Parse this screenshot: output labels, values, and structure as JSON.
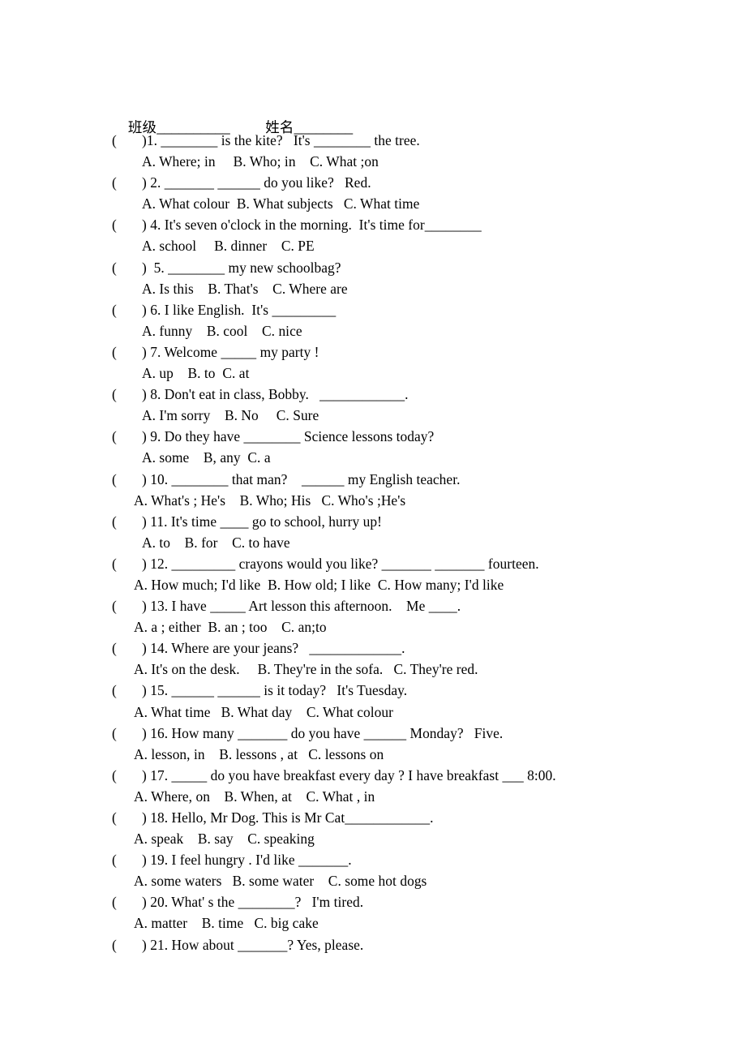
{
  "document": {
    "type": "english-multiple-choice-worksheet",
    "page_background": "#ffffff",
    "text_color": "#000000"
  },
  "header": {
    "class_label": "班级",
    "class_rule": "__________",
    "name_label": "姓名",
    "name_rule": "________"
  },
  "questions": [
    {
      "paren": "(",
      "close": ")",
      "number": "1.",
      "stem": ")1. ________ is the kite?   It's ________ the tree.",
      "options": "A. Where; in     B. Who; in    C. What ;on",
      "options_shift": false
    },
    {
      "paren": "(",
      "close": ")",
      "number": "2.",
      "stem": ") 2. _______ ______ do you like?   Red.",
      "options": "A. What colour  B. What subjects   C. What time",
      "options_shift": false
    },
    {
      "paren": "(",
      "close": ")",
      "number": "4.",
      "stem": ") 4. It's seven o'clock in the morning.  It's time for________",
      "options": "A. school     B. dinner    C. PE",
      "options_shift": false
    },
    {
      "paren": "(",
      "close": ")",
      "number": "5.",
      "stem": ")  5. ________ my new schoolbag?",
      "options": "A. Is this    B. That's    C. Where are",
      "options_shift": false
    },
    {
      "paren": "(",
      "close": ")",
      "number": "6.",
      "stem": ") 6. I like English.  It's _________",
      "options": "A. funny    B. cool    C. nice",
      "options_shift": false
    },
    {
      "paren": "(",
      "close": ")",
      "number": "7.",
      "stem": ") 7. Welcome _____ my party !",
      "options": "A. up    B. to  C. at",
      "options_shift": false
    },
    {
      "paren": "(",
      "close": ")",
      "number": "8.",
      "stem": ") 8. Don't eat in class, Bobby.   ____________.",
      "options": "A. I'm sorry    B. No     C. Sure",
      "options_shift": false
    },
    {
      "paren": "(",
      "close": ")",
      "number": "9.",
      "stem": ") 9. Do they have ________ Science lessons today?",
      "options": "A. some    B, any  C. a",
      "options_shift": false
    },
    {
      "paren": "(",
      "close": ")",
      "number": "10.",
      "stem": ") 10. ________ that man?    ______ my English teacher.",
      "options": "A. What's ; He's    B. Who; His   C. Who's ;He's",
      "options_shift": true
    },
    {
      "paren": "(",
      "close": ")",
      "number": "11.",
      "stem": ") 11. It's time ____ go to school, hurry up!",
      "options": "A. to    B. for    C. to have",
      "options_shift": false
    },
    {
      "paren": "(",
      "close": ")",
      "number": "12.",
      "stem": ") 12. _________ crayons would you like? _______ _______ fourteen.",
      "options": "A. How much; I'd like  B. How old; I like  C. How many; I'd like",
      "options_shift": true
    },
    {
      "paren": "(",
      "close": ")",
      "number": "13.",
      "stem": ") 13. I have _____ Art lesson this afternoon.    Me ____.",
      "options": "A. a ; either  B. an ; too    C. an;to",
      "options_shift": true
    },
    {
      "paren": "(",
      "close": ")",
      "number": "14.",
      "stem": ") 14. Where are your jeans?   _____________.",
      "options": "A. It's on the desk.     B. They're in the sofa.   C. They're red.",
      "options_shift": true
    },
    {
      "paren": "(",
      "close": ")",
      "number": "15.",
      "stem": ") 15. ______ ______ is it today?   It's Tuesday.",
      "options": "A. What time   B. What day    C. What colour",
      "options_shift": true
    },
    {
      "paren": "(",
      "close": ")",
      "number": "16.",
      "stem": ") 16. How many _______ do you have ______ Monday?   Five.",
      "options": "A. lesson, in    B. lessons , at   C. lessons on",
      "options_shift": true
    },
    {
      "paren": "(",
      "close": ")",
      "number": "17.",
      "stem": ") 17. _____ do you have breakfast every day ? I have breakfast ___ 8:00.",
      "options": "A. Where, on    B. When, at    C. What , in",
      "options_shift": true
    },
    {
      "paren": "(",
      "close": ")",
      "number": "18.",
      "stem": ") 18. Hello, Mr Dog. This is Mr Cat____________.",
      "options": "A. speak    B. say    C. speaking",
      "options_shift": true
    },
    {
      "paren": "(",
      "close": ")",
      "number": "19.",
      "stem": ") 19. I feel hungry . I'd like _______.",
      "options": "A. some waters   B. some water    C. some hot dogs",
      "options_shift": true
    },
    {
      "paren": "(",
      "close": ")",
      "number": "20.",
      "stem": ") 20. What' s the ________?   I'm tired.",
      "options": "A. matter    B. time   C. big cake",
      "options_shift": true
    },
    {
      "paren": "(",
      "close": ")",
      "number": "21.",
      "stem": ") 21. How about _______? Yes, please.",
      "options": "",
      "options_shift": true
    }
  ]
}
